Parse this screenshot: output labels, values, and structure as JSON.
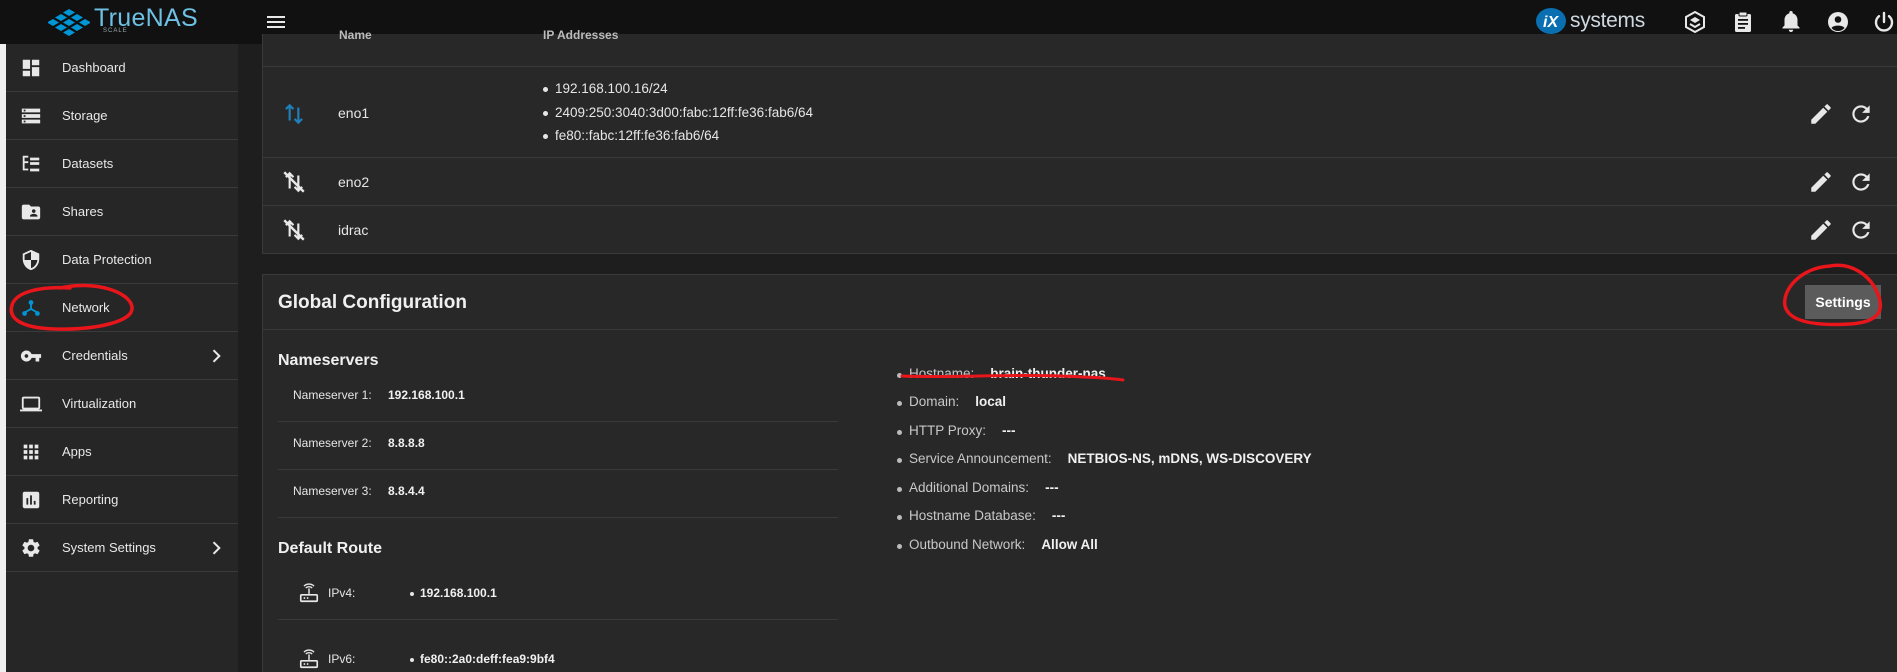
{
  "app": {
    "brand": "TrueNAS",
    "brand_sub": "SCALE",
    "vendor": "systems"
  },
  "topbar_icons": [
    "truecommand-icon",
    "jobs-clipboard-icon",
    "bell-icon",
    "account-circle-icon",
    "power-icon"
  ],
  "sidebar": {
    "items": [
      {
        "label": "Dashboard",
        "icon": "dashboard-icon"
      },
      {
        "label": "Storage",
        "icon": "storage-icon"
      },
      {
        "label": "Datasets",
        "icon": "datasets-icon"
      },
      {
        "label": "Shares",
        "icon": "shares-folder-icon"
      },
      {
        "label": "Data Protection",
        "icon": "shield-icon"
      },
      {
        "label": "Network",
        "icon": "network-icon",
        "active": true
      },
      {
        "label": "Credentials",
        "icon": "key-icon",
        "has_children": true
      },
      {
        "label": "Virtualization",
        "icon": "laptop-icon"
      },
      {
        "label": "Apps",
        "icon": "apps-grid-icon"
      },
      {
        "label": "Reporting",
        "icon": "reporting-icon"
      },
      {
        "label": "System Settings",
        "icon": "gear-icon",
        "has_children": true
      }
    ]
  },
  "interfaces": {
    "header": {
      "name": "Name",
      "ip": "IP Addresses"
    },
    "rows": [
      {
        "name": "eno1",
        "status": "link-up",
        "addresses": [
          "192.168.100.16/24",
          "2409:250:3040:3d00:fabc:12ff:fe36:fab6/64",
          "fe80::fabc:12ff:fe36:fab6/64"
        ]
      },
      {
        "name": "eno2",
        "status": "link-down",
        "addresses": []
      },
      {
        "name": "idrac",
        "status": "link-down",
        "addresses": []
      }
    ]
  },
  "global_config": {
    "title": "Global Configuration",
    "settings_label": "Settings",
    "nameservers_title": "Nameservers",
    "nameservers": [
      {
        "label": "Nameserver 1:",
        "value": "192.168.100.1"
      },
      {
        "label": "Nameserver 2:",
        "value": "8.8.8.8"
      },
      {
        "label": "Nameserver 3:",
        "value": "8.8.4.4"
      }
    ],
    "default_route_title": "Default Route",
    "routes": [
      {
        "label": "IPv4:",
        "value": "192.168.100.1"
      },
      {
        "label": "IPv6:",
        "value": "fe80::2a0:deff:fea9:9bf4"
      }
    ],
    "properties": [
      {
        "label": "Hostname:",
        "value": "brain-thunder-nas"
      },
      {
        "label": "Domain:",
        "value": "local"
      },
      {
        "label": "HTTP Proxy:",
        "value": "---"
      },
      {
        "label": "Service Announcement:",
        "value": "NETBIOS-NS, mDNS, WS-DISCOVERY"
      },
      {
        "label": "Additional Domains:",
        "value": "---"
      },
      {
        "label": "Hostname Database:",
        "value": "---"
      },
      {
        "label": "Outbound Network:",
        "value": "Allow All"
      }
    ]
  },
  "colors": {
    "accent": "#0095d5",
    "annotation": "#e8151b",
    "link_up": "#1f7fb8"
  }
}
